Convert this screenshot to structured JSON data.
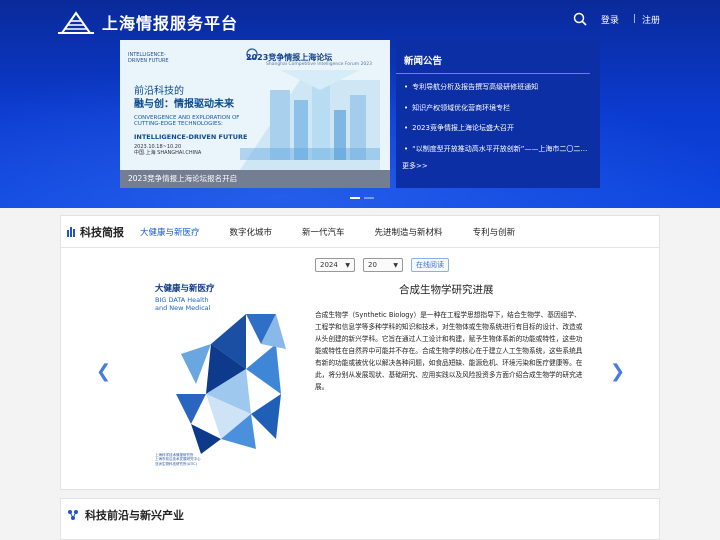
{
  "header": {
    "site_title": "上海情报服务平台",
    "login": "登录",
    "separator": "|",
    "register": "注册"
  },
  "banner": {
    "brand_line1": "INTELLIGENCE-",
    "brand_line2": "DRIVEN FUTURE",
    "title_line1": "前沿科技的",
    "title_line2": "融与创：情报驱动未来",
    "en_line1": "CONVERGENCE AND EXPLORATION OF",
    "en_line2": "CUTTING-EDGE TECHNOLOGIES:",
    "en_line3": "INTELLIGENCE-DRIVEN FUTURE",
    "date_line1": "2023.10.18~10.20",
    "date_line2": "中国.上海 SHANGHAI.CHINA",
    "forum_title": "2023竞争情报上海论坛",
    "forum_en": "Shanghai Competitive Intelligence Forum 2023",
    "caption": "2023竞争情报上海论坛报名开启"
  },
  "news": {
    "heading": "新闻公告",
    "items": [
      "专利导航分析及报告撰写高级研修班通知",
      "知识产权领域优化营商环境专栏",
      "2023竞争情报上海论坛盛大召开",
      "“以制度型开放推动高水平开放创新”——上海市二〇二三年度…"
    ],
    "more": "更多>>"
  },
  "section1": {
    "title": "科技简报",
    "tabs": [
      "大健康与新医疗",
      "数字化城市",
      "新一代汽车",
      "先进制造与新材料",
      "专利与创新"
    ],
    "active_tab": 0,
    "year": "2024",
    "issue": "20",
    "read_online": "在线阅读",
    "cover_title": "大健康与新医疗",
    "cover_en_line1": "BIG DATA Health",
    "cover_en_line2": "and New Medical",
    "cover_footer_line1": "上海科学技术情报研究所",
    "cover_footer_line2": "上海市前沿技术发展研究中心",
    "cover_footer_line3": "亚洲生物科技研究所(ATIC)",
    "doc_title": "合成生物学研究进展",
    "doc_body": "合成生物学（Synthetic Biology）是一种在工程学思想指导下，结合生物学、基因组学、工程学和信息学等多种学科的知识和技术，对生物体或生物系统进行有目标的设计、改造或从头创建的新兴学科。它旨在通过人工设计和构建，赋予生物体系新的功能或特性，这些功能或特性在自然界中可能并不存在。合成生物学的核心在于建立人工生物系统，这些系统具有新的功能或被优化以解决各种问题，如食品短缺、能源危机、环境污染和医疗健康等。在此，将分别从发展现状、基础研究、应用实践以及风险投资多方面介绍合成生物学的研究进展。"
  },
  "section2": {
    "title": "科技前沿与新兴产业"
  },
  "colors": {
    "header_blue": "#0b3bd0",
    "news_panel": "#0d2fa6",
    "accent": "#1a5ad0"
  }
}
